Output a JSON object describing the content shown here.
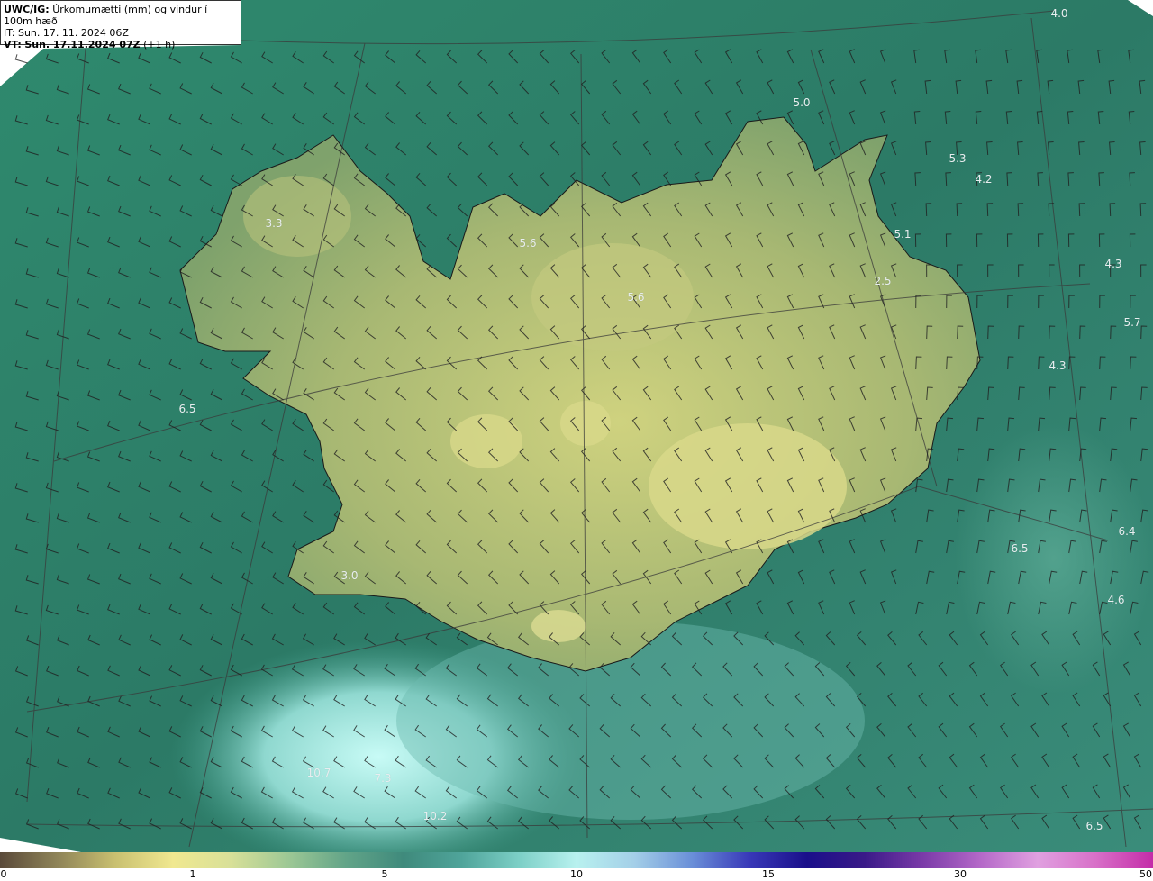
{
  "header": {
    "product": "UWC/IG:",
    "title": "Úrkomumætti (mm) og vindur í 100m hæð",
    "it_line": "IT: Sun. 17. 11. 2024 06Z",
    "vt_prefix": "VT:",
    "vt_bold": "Sun. 17.11.2024 07Z",
    "vt_suffix": "(+1 h)"
  },
  "field_labels": [
    {
      "id": "l1",
      "text": "4.0"
    },
    {
      "id": "l2",
      "text": "5.0"
    },
    {
      "id": "l3",
      "text": "5.3"
    },
    {
      "id": "l4",
      "text": "4.2"
    },
    {
      "id": "l5",
      "text": "3.3"
    },
    {
      "id": "l6",
      "text": "5.6"
    },
    {
      "id": "l7",
      "text": "5.1"
    },
    {
      "id": "l8",
      "text": "4.3"
    },
    {
      "id": "l9",
      "text": "2.5"
    },
    {
      "id": "l10",
      "text": "5.6"
    },
    {
      "id": "l11",
      "text": "5.7"
    },
    {
      "id": "l12",
      "text": "4.3"
    },
    {
      "id": "l13",
      "text": "6.5"
    },
    {
      "id": "l14",
      "text": "6.4"
    },
    {
      "id": "l15",
      "text": "6.5"
    },
    {
      "id": "l16",
      "text": "3.0"
    },
    {
      "id": "l17",
      "text": "4.6"
    },
    {
      "id": "l18",
      "text": "10.7"
    },
    {
      "id": "l19",
      "text": "7.3"
    },
    {
      "id": "l20",
      "text": "10.2"
    },
    {
      "id": "l21",
      "text": "6.5"
    }
  ],
  "colorbar": {
    "unit": "mm",
    "ticks": [
      "0",
      "1",
      "5",
      "10",
      "15",
      "30",
      "50"
    ],
    "colors": [
      "#5a4a3a",
      "#8f8458",
      "#c9c070",
      "#f0e890",
      "#d8e098",
      "#9dc895",
      "#62a488",
      "#3f8a7c",
      "#4fa49a",
      "#7ccfc6",
      "#b8f1ef",
      "#a4cfe8",
      "#6a8fd8",
      "#3838b8",
      "#1a0f8a",
      "#3a1a88",
      "#7a3aa8",
      "#b468c8",
      "#e0a0e0",
      "#d870c8",
      "#c42ca8"
    ]
  },
  "legend": {
    "land_color": "#bfc67e",
    "sea_color": "#2f7f6a",
    "rain_color": "#a9e6e2"
  }
}
